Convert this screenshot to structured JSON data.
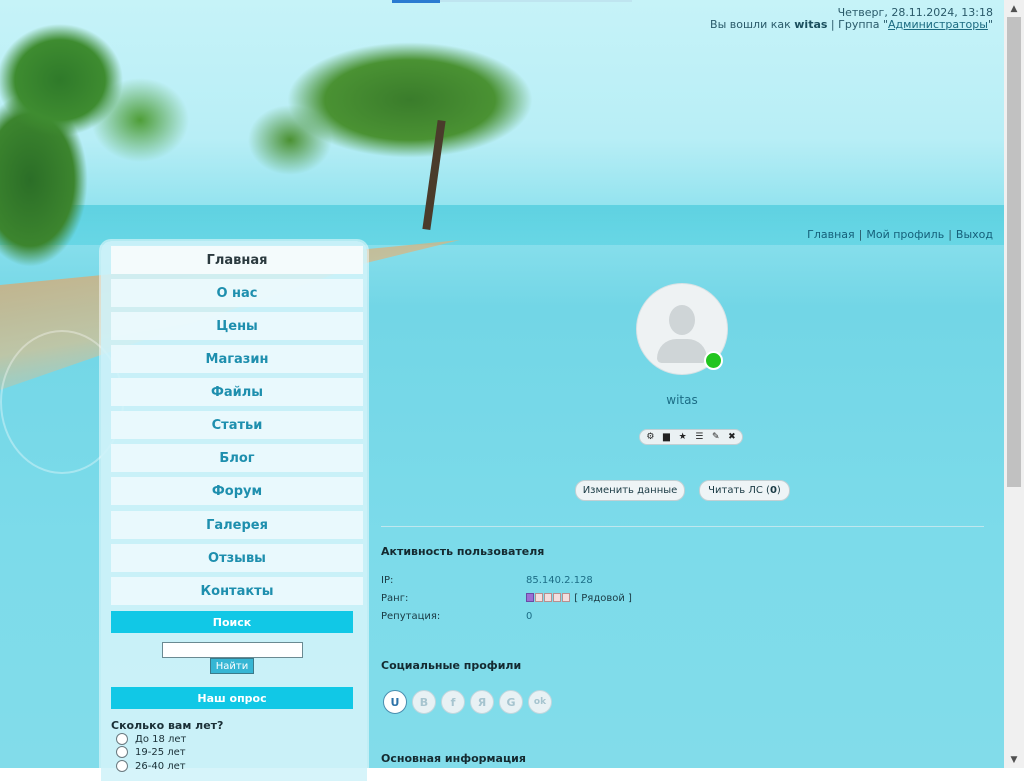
{
  "header": {
    "datetime": "Четверг, 28.11.2024, 13:18",
    "login_prefix": "Вы вошли как ",
    "username": "witas",
    "group_prefix": " | Группа \"",
    "group_name": "Администраторы",
    "group_suffix": "\""
  },
  "user_menu": {
    "items": [
      "Главная",
      "Мой профиль",
      "Выход"
    ],
    "separator": "|"
  },
  "nav": {
    "items": [
      "Главная",
      "О нас",
      "Цены",
      "Магазин",
      "Файлы",
      "Статьи",
      "Блог",
      "Форум",
      "Галерея",
      "Отзывы",
      "Контакты"
    ],
    "active_index": 0
  },
  "search": {
    "title": "Поиск",
    "button": "Найти",
    "value": ""
  },
  "poll": {
    "title": "Наш опрос",
    "question": "Сколько вам лет?",
    "options": [
      "До 18 лет",
      "19-25 лет",
      "26-40 лет"
    ]
  },
  "profile": {
    "username": "witas",
    "online": true,
    "action_icons": [
      "gear-icon",
      "stats-icon",
      "star-icon",
      "list-icon",
      "pencil-icon",
      "close-icon"
    ],
    "buttons": {
      "edit": "Изменить данные",
      "read_pm_prefix": "Читать ЛС (",
      "pm_count": "0",
      "read_pm_suffix": ")"
    },
    "activity": {
      "title": "Активность пользователя",
      "ip_label": "IP:",
      "ip": "85.140.2.128",
      "rank_label": "Ранг:",
      "rank_level": 1,
      "rank_max": 5,
      "rank_name": "[ Рядовой ]",
      "reputation_label": "Репутация:",
      "reputation": "0"
    },
    "socials": {
      "title": "Социальные профили",
      "items": [
        "U",
        "B",
        "f",
        "Я",
        "G",
        "ok"
      ]
    },
    "main_info_title": "Основная информация"
  },
  "colors": {
    "accent": "#11c8e6",
    "link": "#1c6d86",
    "online": "#22c51e"
  }
}
